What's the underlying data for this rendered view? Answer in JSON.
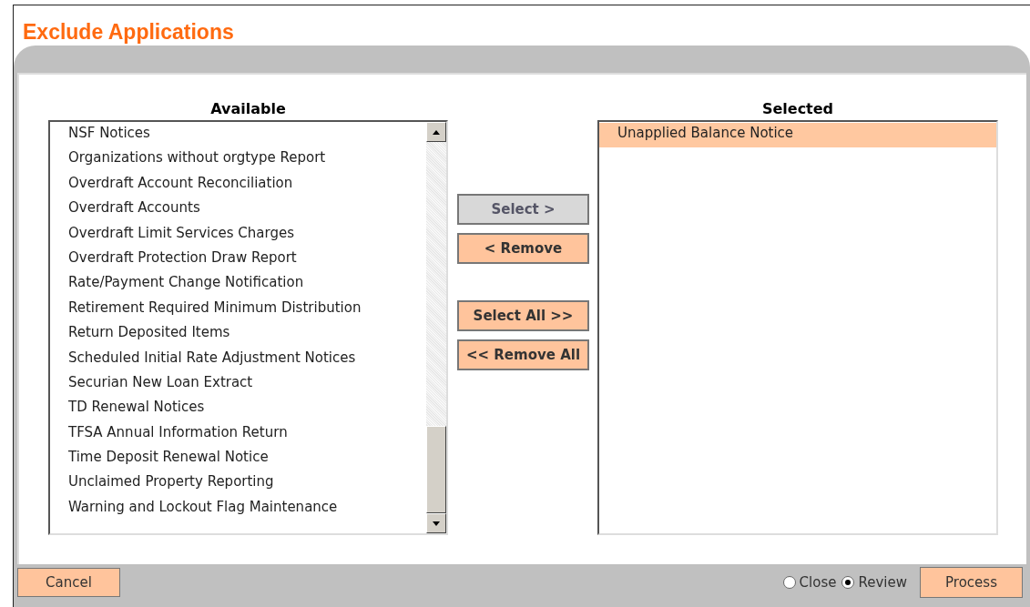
{
  "title": "Exclude Applications",
  "available": {
    "heading": "Available",
    "items": [
      {
        "label": "NSF Notices",
        "selected": false
      },
      {
        "label": "Organizations without orgtype Report",
        "selected": false
      },
      {
        "label": "Overdraft Account Reconciliation",
        "selected": false
      },
      {
        "label": "Overdraft Accounts",
        "selected": false
      },
      {
        "label": "Overdraft Limit Services Charges",
        "selected": false
      },
      {
        "label": "Overdraft Protection Draw Report",
        "selected": false
      },
      {
        "label": "Rate/Payment Change Notification",
        "selected": false
      },
      {
        "label": "Retirement Required Minimum Distribution",
        "selected": false
      },
      {
        "label": "Return Deposited Items",
        "selected": false
      },
      {
        "label": "Scheduled Initial Rate Adjustment Notices",
        "selected": false
      },
      {
        "label": "Securian New Loan Extract",
        "selected": false
      },
      {
        "label": "TD Renewal Notices",
        "selected": false
      },
      {
        "label": "TFSA Annual Information Return",
        "selected": false
      },
      {
        "label": "Time Deposit Renewal Notice",
        "selected": false
      },
      {
        "label": "Unclaimed Property Reporting",
        "selected": false
      },
      {
        "label": "Warning and Lockout Flag Maintenance",
        "selected": false
      }
    ]
  },
  "transfer_buttons": [
    {
      "label": "Select >",
      "disabled": true
    },
    {
      "label": "< Remove",
      "disabled": false
    },
    {
      "label": "Select All >>",
      "disabled": false
    },
    {
      "label": "<< Remove All",
      "disabled": false
    }
  ],
  "selected_list": {
    "heading": "Selected",
    "items": [
      {
        "label": "Unapplied Balance Notice",
        "selected": true
      }
    ]
  },
  "footer": {
    "cancel": "Cancel",
    "options": [
      {
        "label": "Close",
        "selected": false
      },
      {
        "label": "Review",
        "selected": true
      }
    ],
    "process": "Process"
  }
}
